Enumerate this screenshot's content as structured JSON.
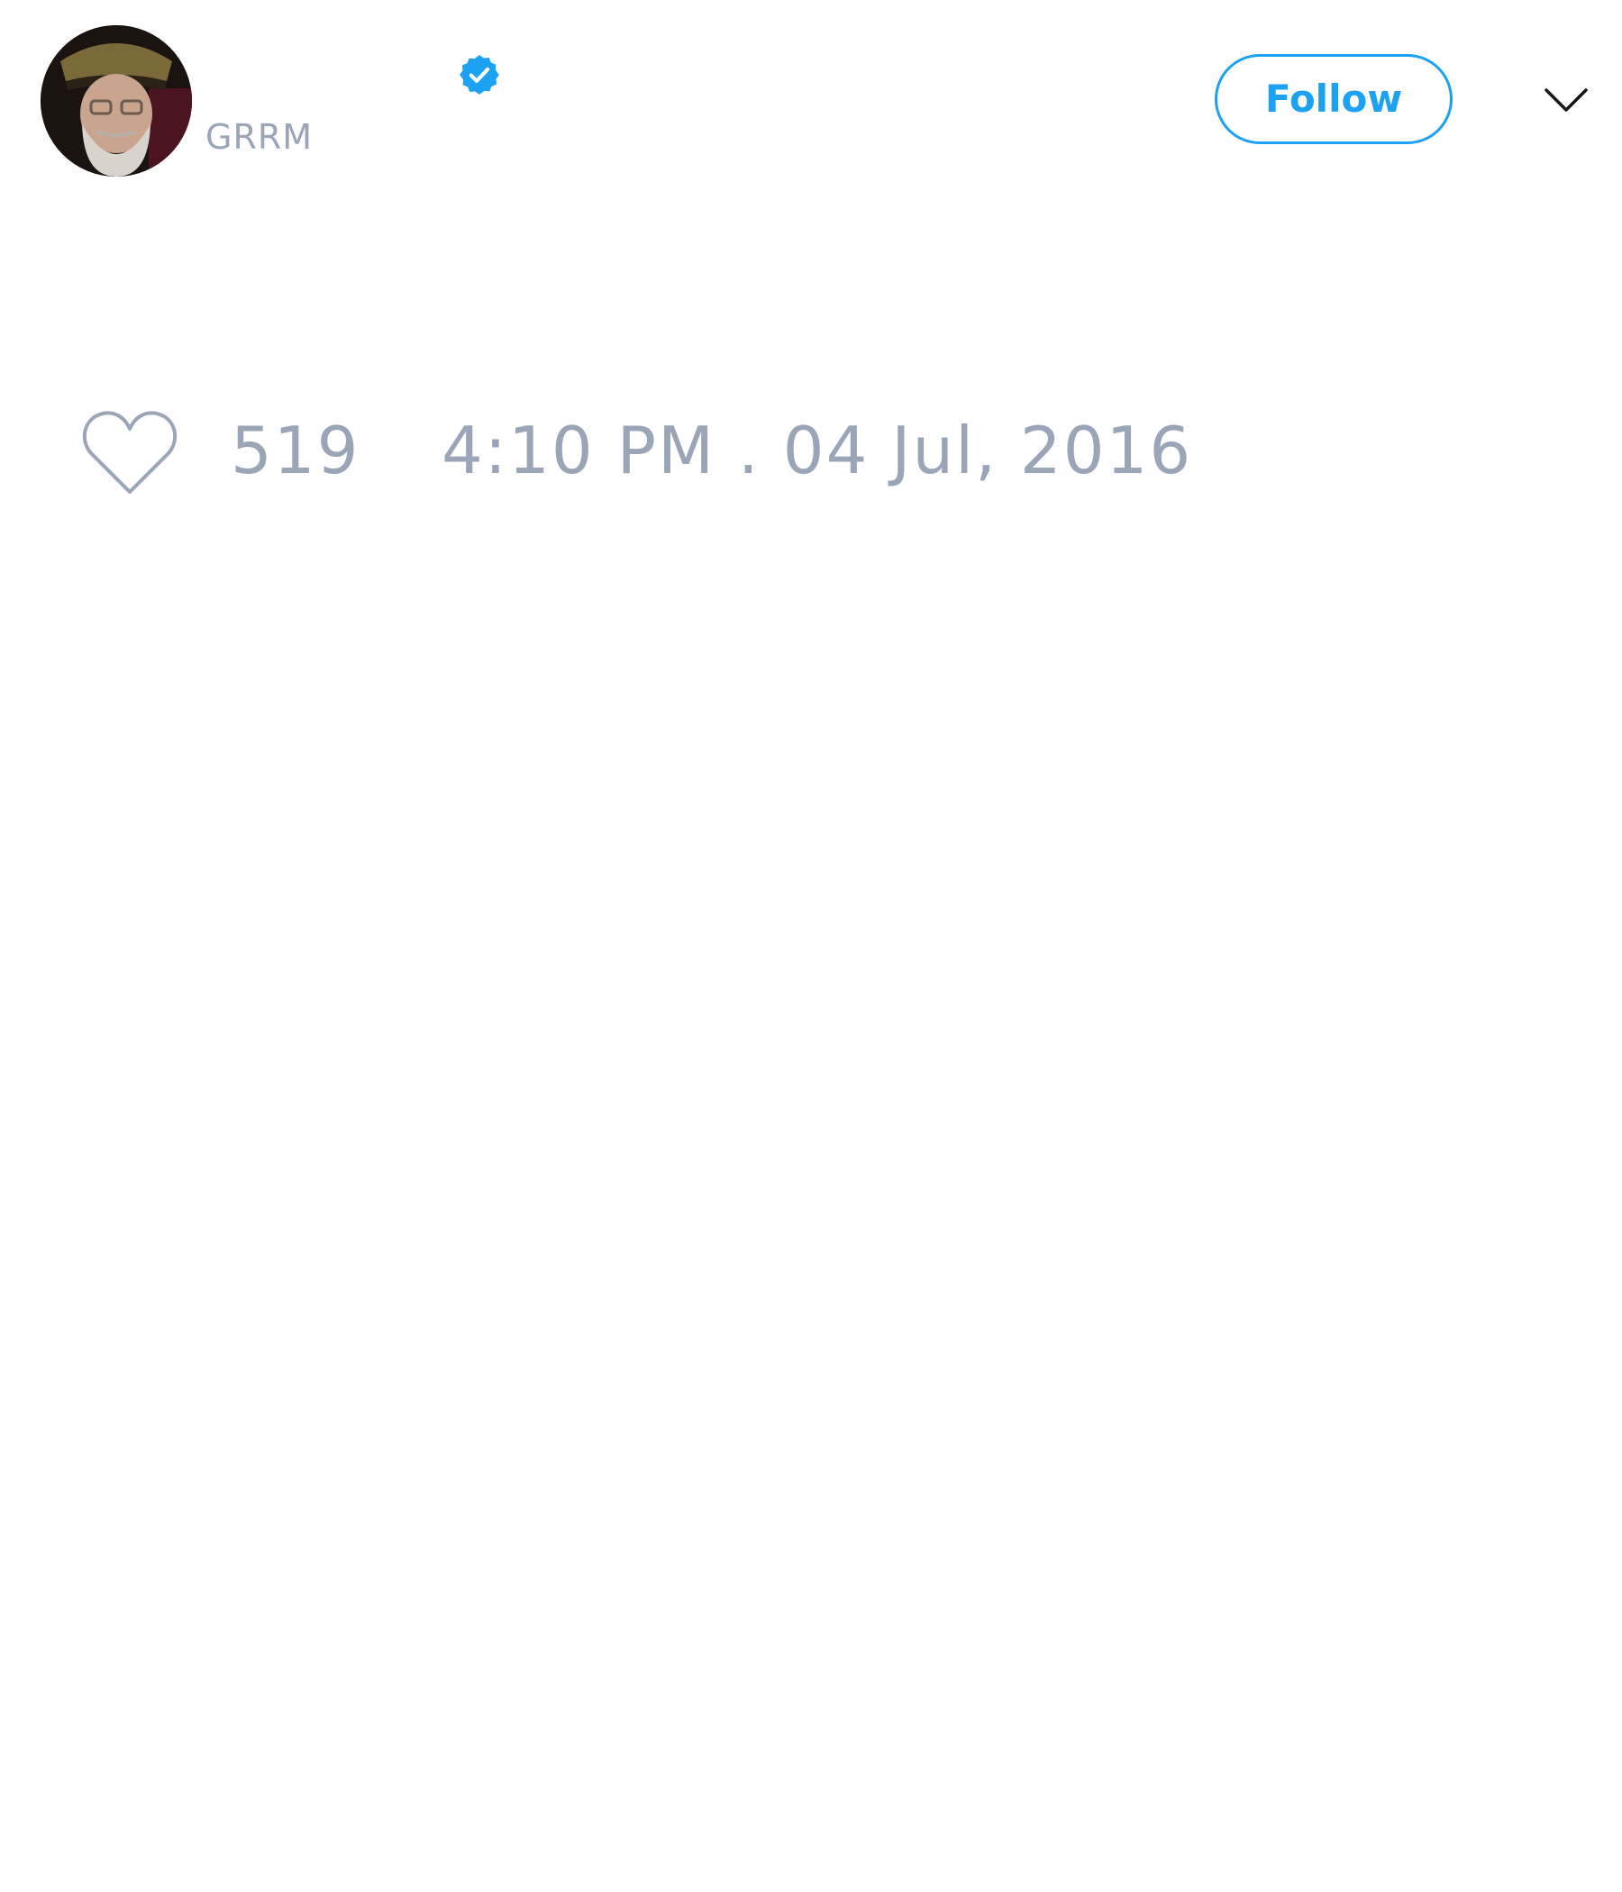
{
  "tweet": {
    "author": {
      "display_name": "",
      "handle": "GRRM",
      "verified": true,
      "avatar_icon": "profile-photo"
    },
    "follow_label": "Follow",
    "menu_icon": "chevron-down-icon",
    "likes": {
      "icon": "heart-icon",
      "count": "519"
    },
    "timestamp": "4:10 PM . 04 Jul, 2016"
  },
  "colors": {
    "accent": "#1da1f2",
    "muted_text": "#9aa6b8",
    "background": "#ffffff"
  }
}
